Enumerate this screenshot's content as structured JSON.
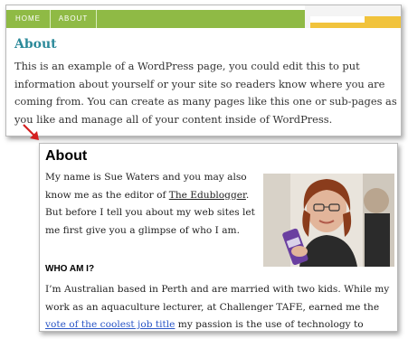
{
  "nav": {
    "home": "HOME",
    "about": "ABOUT"
  },
  "panel1": {
    "title": "About",
    "text": "This is an example of a WordPress page, you could edit this to put information about yourself or your site so readers know where you are coming from. You can create as many pages like this one or sub-pages as you like and manage all of your content inside of WordPress."
  },
  "panel2": {
    "title": "About",
    "intro_before": "My name is Sue Waters and you may also know me as the editor of ",
    "intro_link": "The Edublogger",
    "intro_after": ". But before I tell you about my web sites let me first give you a glimpse of who I am.",
    "heading": "WHO AM I?",
    "body_before": "I’m Australian based in Perth and are married with two kids. While my work as an aquaculture lecturer, at Challenger TAFE, earned me the ",
    "body_link": "vote of the coolest job title",
    "body_after": " my passion is the use of technology to enhance student learning."
  },
  "colors": {
    "nav_green": "#8fba45",
    "title_teal": "#2c8a9a",
    "link_blue": "#2a56c6",
    "arrow_red": "#d42020"
  },
  "icons": {
    "arrow": "red-arrow-icon",
    "photo": "profile-photo"
  }
}
